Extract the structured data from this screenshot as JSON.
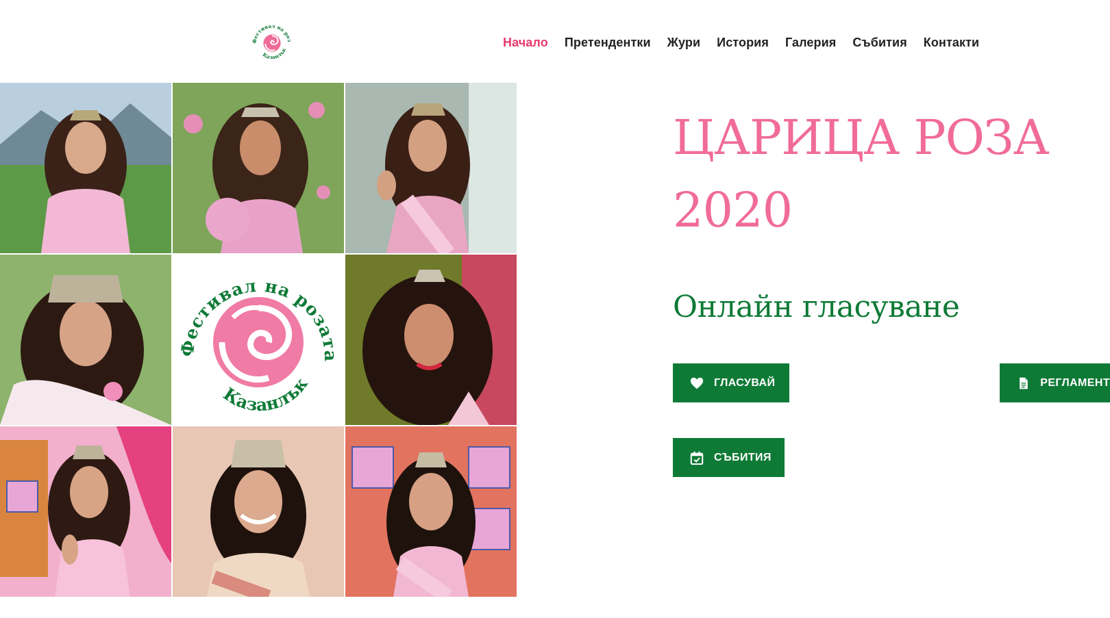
{
  "header": {
    "logo": {
      "top_arc": "Фестивал на розата",
      "bottom_arc": "Казанлък"
    },
    "nav": [
      {
        "label": "Начало",
        "active": true
      },
      {
        "label": "Претендентки",
        "active": false
      },
      {
        "label": "Жури",
        "active": false
      },
      {
        "label": "История",
        "active": false
      },
      {
        "label": "Галерия",
        "active": false
      },
      {
        "label": "Събития",
        "active": false
      },
      {
        "label": "Контакти",
        "active": false
      }
    ]
  },
  "grid": {
    "center_logo": {
      "top_arc": "Фестивал на розата",
      "bottom_arc": "Казанлък"
    }
  },
  "hero": {
    "title_line1": "ЦАРИЦА РОЗА",
    "title_line2": "2020",
    "subtitle": "Онлайн гласуване"
  },
  "buttons": {
    "vote": {
      "label": "ГЛАСУВАЙ",
      "icon": "heart-icon"
    },
    "rules": {
      "label": "РЕГЛАМЕНТ",
      "icon": "document-icon"
    },
    "events": {
      "label": "СЪБИТИЯ",
      "icon": "calendar-check-icon"
    }
  },
  "colors": {
    "accent_pink": "#f06c97",
    "nav_active": "#e8386d",
    "green": "#0e7a36",
    "nav_text": "#222222"
  }
}
